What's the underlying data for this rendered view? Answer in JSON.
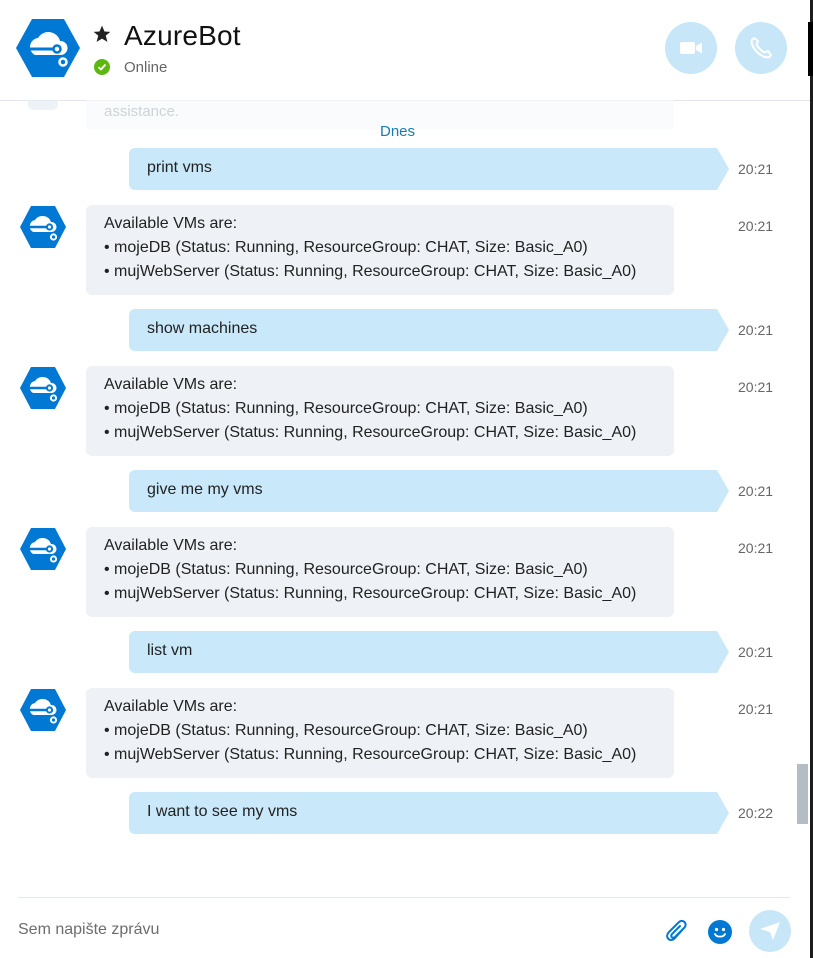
{
  "header": {
    "contact_name": "AzureBot",
    "presence": "Online",
    "video_icon": "video-camera-icon",
    "call_icon": "phone-icon",
    "favorite_icon": "star-icon"
  },
  "conversation": {
    "previous_fragment": "assistance.",
    "day_separator": "Dnes",
    "messages": [
      {
        "from": "me",
        "text": "print vms",
        "time": "20:21"
      },
      {
        "from": "bot",
        "lines": [
          "Available VMs are:",
          "• mojeDB (Status: Running, ResourceGroup: CHAT, Size: Basic_A0)",
          "• mujWebServer (Status: Running, ResourceGroup: CHAT, Size: Basic_A0)"
        ],
        "time": "20:21"
      },
      {
        "from": "me",
        "text": "show machines",
        "time": "20:21"
      },
      {
        "from": "bot",
        "lines": [
          "Available VMs are:",
          "• mojeDB (Status: Running, ResourceGroup: CHAT, Size: Basic_A0)",
          "• mujWebServer (Status: Running, ResourceGroup: CHAT, Size: Basic_A0)"
        ],
        "time": "20:21"
      },
      {
        "from": "me",
        "text": "give me my vms",
        "time": "20:21"
      },
      {
        "from": "bot",
        "lines": [
          "Available VMs are:",
          "• mojeDB (Status: Running, ResourceGroup: CHAT, Size: Basic_A0)",
          "• mujWebServer (Status: Running, ResourceGroup: CHAT, Size: Basic_A0)"
        ],
        "time": "20:21"
      },
      {
        "from": "me",
        "text": "list vm",
        "time": "20:21"
      },
      {
        "from": "bot",
        "lines": [
          "Available VMs are:",
          "• mojeDB (Status: Running, ResourceGroup: CHAT, Size: Basic_A0)",
          "• mujWebServer (Status: Running, ResourceGroup: CHAT, Size: Basic_A0)"
        ],
        "time": "20:21"
      },
      {
        "from": "me",
        "text": "I want to see my vms",
        "time": "20:22"
      }
    ]
  },
  "composer": {
    "placeholder": "Sem napište zprávu",
    "attach_icon": "paperclip-icon",
    "emoji_icon": "emoji-icon",
    "send_icon": "send-icon"
  },
  "colors": {
    "accent": "#0078d4",
    "outgoing_bubble": "#c9e8f9",
    "incoming_bubble": "#eef1f5",
    "online": "#5cb811"
  }
}
